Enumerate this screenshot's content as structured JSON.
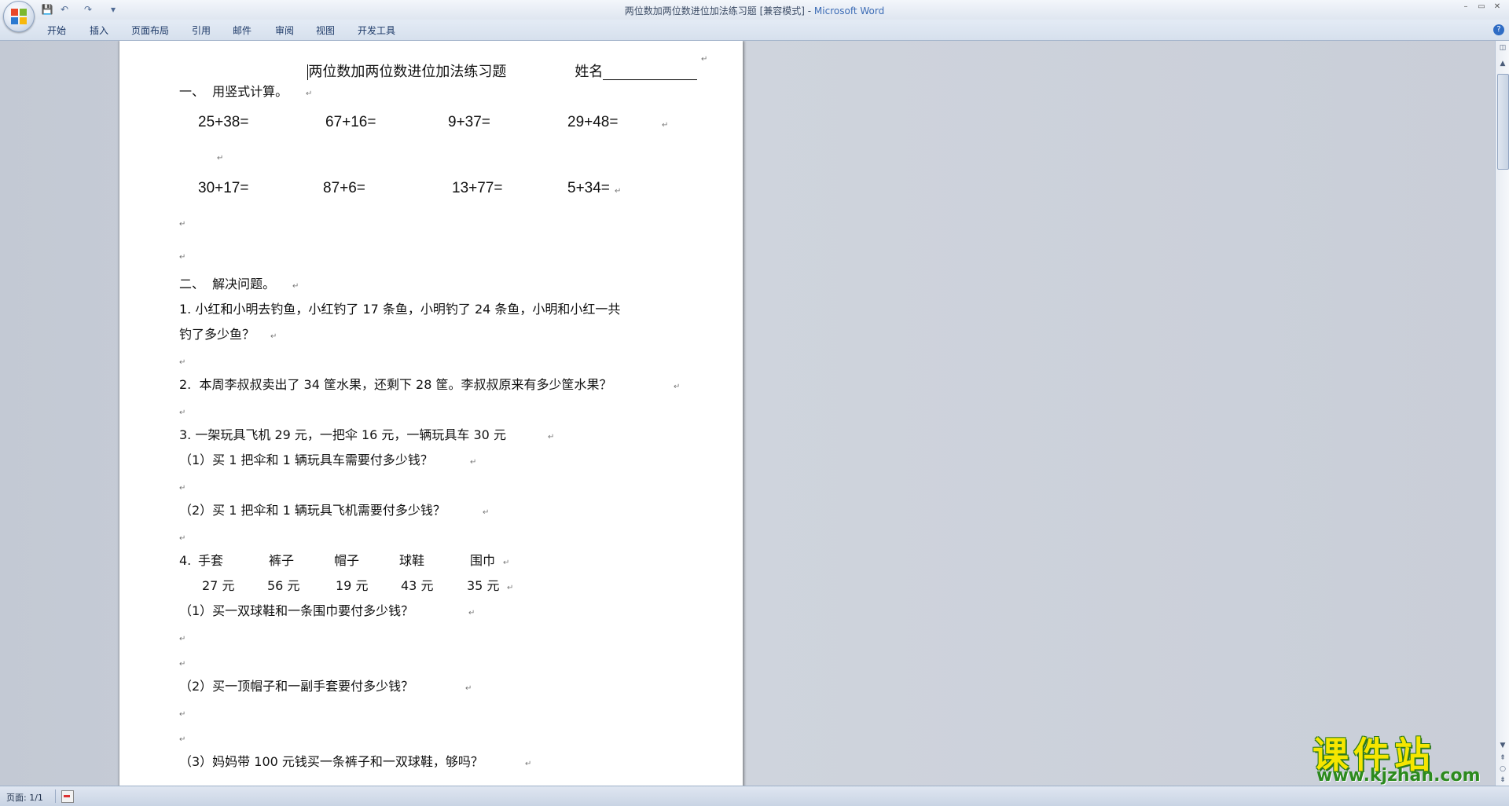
{
  "window": {
    "document_title": "两位数加两位数进位加法练习题 [兼容模式] - ",
    "app_name": "Microsoft Word",
    "controls": [
      "–",
      "▭",
      "✕"
    ]
  },
  "quick_access": {
    "save": "💾",
    "undo": "↶",
    "redo": "↷",
    "customize": "▾"
  },
  "ribbon": {
    "tabs": [
      "开始",
      "插入",
      "页面布局",
      "引用",
      "邮件",
      "审阅",
      "视图",
      "开发工具"
    ],
    "help": "?"
  },
  "document": {
    "title": "两位数加两位数进位加法练习题",
    "name_label": "姓名",
    "section1": "一、  用竖式计算。",
    "row1": [
      "25+38=",
      "67+16=",
      "9+37=",
      "29+48="
    ],
    "row2": [
      "30+17=",
      "87+6=",
      "13+77=",
      "5+34="
    ],
    "section2": "二、  解决问题。",
    "q1a": "1. 小红和小明去钓鱼，小红钓了 17 条鱼，小明钓了 24 条鱼，小明和小红一共",
    "q1b": "钓了多少鱼？",
    "q2": "2.  本周李叔叔卖出了 34 筐水果，还剩下 28 筐。李叔叔原来有多少筐水果？",
    "q3": "3. 一架玩具飞机 29 元，一把伞 16 元，一辆玩具车 30 元",
    "q3_1": "（1）买 1 把伞和 1 辆玩具车需要付多少钱？",
    "q3_2": "（2）买 1 把伞和 1 辆玩具飞机需要付多少钱？",
    "q4_num": "4.",
    "q4_items": [
      "手套",
      "裤子",
      "帽子",
      "球鞋",
      "围巾"
    ],
    "q4_prices": [
      "27 元",
      "56 元",
      "19 元",
      "43 元",
      "35 元"
    ],
    "q4_1": "（1）买一双球鞋和一条围巾要付多少钱？",
    "q4_2": "（2）买一顶帽子和一副手套要付多少钱？",
    "q4_3": "（3）妈妈带 100 元钱买一条裤子和一双球鞋，够吗？",
    "paragraph_mark": "↵"
  },
  "statusbar": {
    "page": "页面: 1/1"
  },
  "watermark": {
    "cn": "课件站",
    "url": "www.kjzhan.com"
  }
}
